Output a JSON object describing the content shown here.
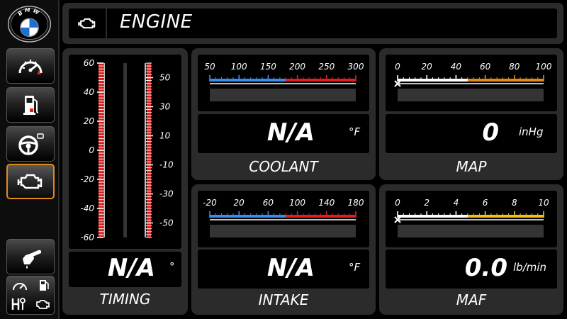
{
  "header": {
    "title": "ENGINE",
    "icon": "check-engine-icon"
  },
  "sidebar": {
    "logo": {
      "letters": "BMW"
    },
    "buttons": [
      {
        "name": "gauge-button",
        "icon": "speedometer-icon",
        "active": false
      },
      {
        "name": "fuel-button",
        "icon": "fuel-pump-icon",
        "active": false
      },
      {
        "name": "steering-button",
        "icon": "steering-wheel-icon",
        "active": false
      },
      {
        "name": "engine-button",
        "icon": "check-engine-icon",
        "active": true
      },
      {
        "name": "fuel-nozzle-button",
        "icon": "fuel-nozzle-icon",
        "active": false
      },
      {
        "name": "overview-button",
        "icon": "multi-gauge-icon",
        "active": false
      }
    ]
  },
  "timing": {
    "label": "TIMING",
    "value": "N/A",
    "unit": "°",
    "left_scale": [
      "60",
      "40",
      "20",
      "0",
      "-20",
      "-40",
      "-60"
    ],
    "right_scale": [
      "50",
      "30",
      "10",
      "-10",
      "-30",
      "-50"
    ]
  },
  "coolant": {
    "label": "COOLANT",
    "value": "N/A",
    "unit": "°F",
    "scale": [
      "50",
      "100",
      "150",
      "200",
      "250",
      "300"
    ]
  },
  "intake": {
    "label": "INTAKE",
    "value": "N/A",
    "unit": "°F",
    "scale": [
      "-20",
      "20",
      "60",
      "100",
      "140",
      "180"
    ]
  },
  "map": {
    "label": "MAP",
    "value": "0",
    "unit": "inHg",
    "scale": [
      "0",
      "20",
      "40",
      "60",
      "80",
      "100"
    ]
  },
  "maf": {
    "label": "MAF",
    "value": "0.0",
    "unit": "lb/min",
    "scale": [
      "0",
      "2",
      "4",
      "6",
      "8",
      "10"
    ]
  },
  "colors": {
    "accent_orange": "#e08a1a",
    "tick_blue": "#3c8cf0",
    "tick_red": "#e02020",
    "tick_orange": "#e08a1a",
    "tick_yellow": "#f0c020",
    "panel_gray": "#2b2b2b"
  }
}
